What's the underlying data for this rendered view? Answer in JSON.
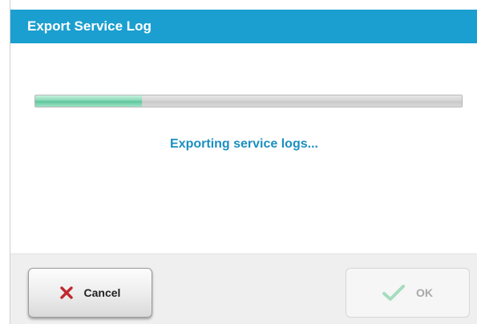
{
  "dialog": {
    "title": "Export Service Log",
    "status_text": "Exporting service logs...",
    "progress_fraction": 0.25
  },
  "buttons": {
    "cancel_label": "Cancel",
    "cancel_icon": "close-x-icon",
    "ok_label": "OK",
    "ok_icon": "checkmark-icon"
  },
  "colors": {
    "title_bar": "#1b9fd0",
    "status_text": "#1b8fc0",
    "progress_fill": "#5fc79e",
    "cancel_icon": "#c0282e",
    "ok_icon_disabled": "#a6dcc0"
  }
}
